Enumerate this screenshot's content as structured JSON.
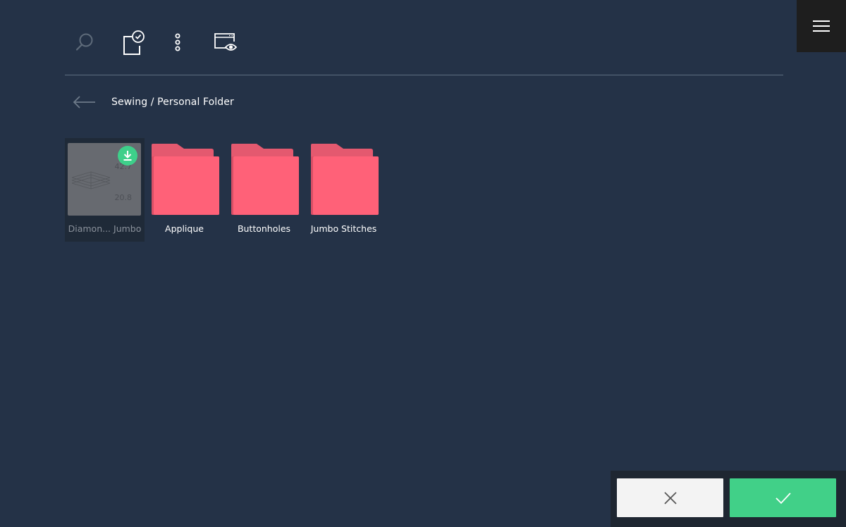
{
  "toolbar": {
    "items": [
      {
        "name": "search",
        "icon": "search-icon"
      },
      {
        "name": "select",
        "icon": "select-checkbox-icon"
      },
      {
        "name": "more",
        "icon": "more-vertical-icon"
      },
      {
        "name": "preview",
        "icon": "window-preview-icon"
      }
    ]
  },
  "menu": {
    "icon": "hamburger-menu-icon"
  },
  "breadcrumb": {
    "back_icon": "arrow-left-icon",
    "path": "Sewing / Personal Folder"
  },
  "files": [
    {
      "type": "file",
      "label": "Diamon... Jumbo",
      "selected": true,
      "dimension_top": "42.7",
      "dimension_bottom": "20.8",
      "badge_icon": "download-icon"
    }
  ],
  "folders": [
    {
      "label": "Applique",
      "icon": "folder-icon"
    },
    {
      "label": "Buttonholes",
      "icon": "folder-icon"
    },
    {
      "label": "Jumbo Stitches",
      "icon": "folder-icon"
    }
  ],
  "colors": {
    "background": "#243247",
    "folder": "#ff6178",
    "folder_tab": "#e4596f",
    "confirm": "#41d088",
    "cancel": "#f3f3f3",
    "badge": "#3ecf8a"
  },
  "actions": {
    "cancel_icon": "close-icon",
    "confirm_icon": "checkmark-icon"
  }
}
